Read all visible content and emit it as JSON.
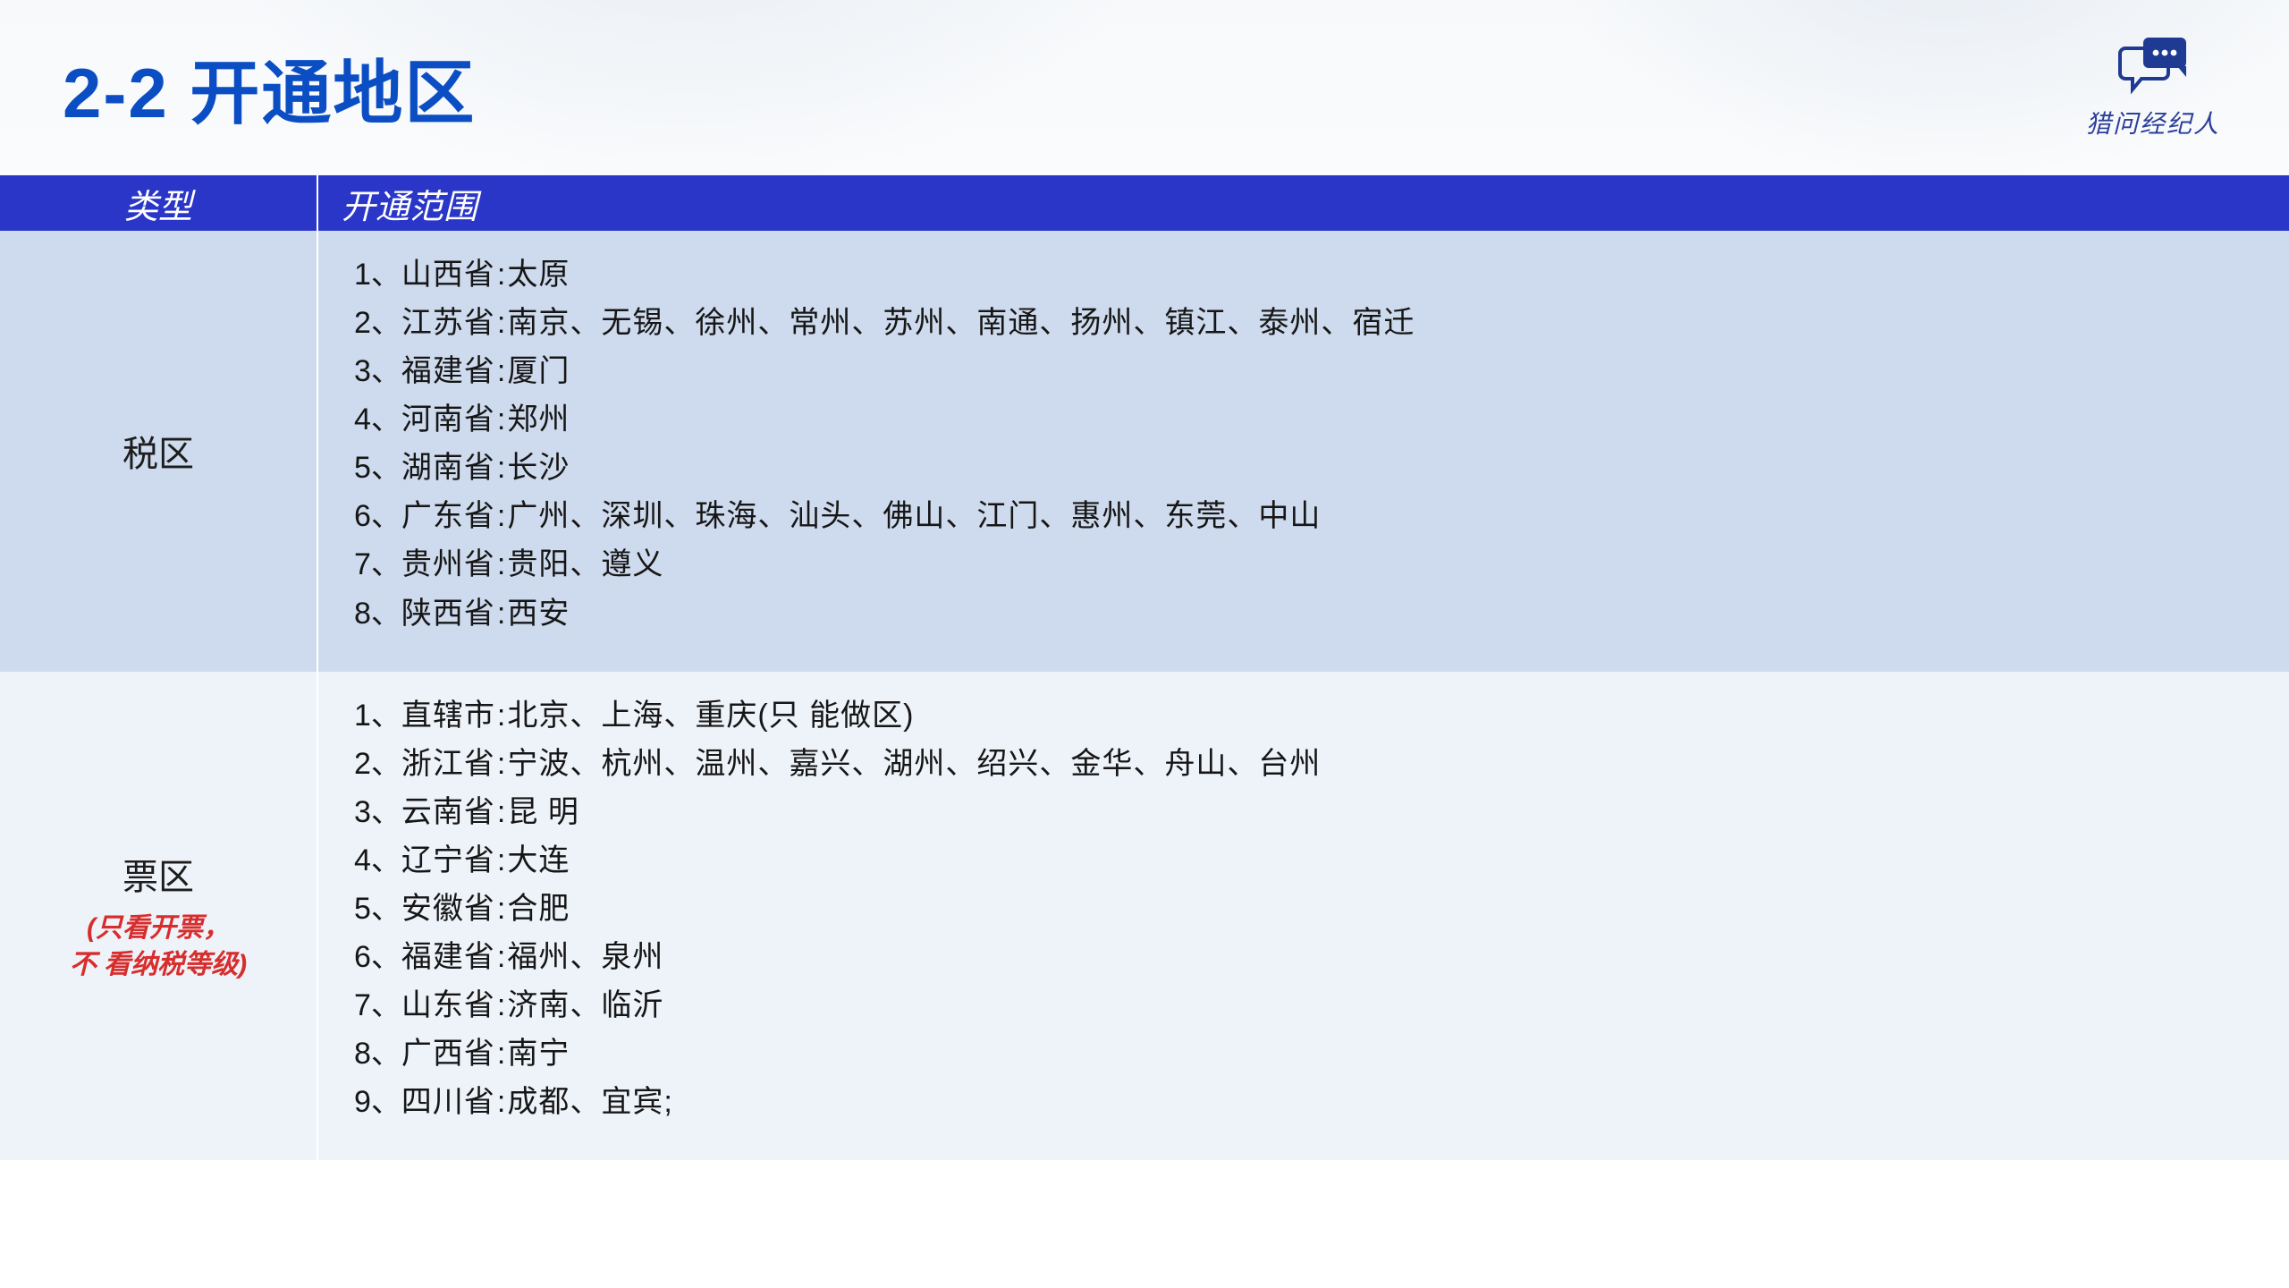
{
  "title": "2-2 开通地区",
  "brand": {
    "label": "猎问经纪人"
  },
  "table": {
    "headers": {
      "type": "类型",
      "scope": "开通范围"
    },
    "rows": [
      {
        "id": "tax",
        "type_label": "税区",
        "type_sub": [],
        "items": [
          {
            "prov": "山西省",
            "cities": "太原"
          },
          {
            "prov": "江苏省",
            "cities": "南京、无锡、徐州、常州、苏州、南通、扬州、镇江、泰州、宿迁"
          },
          {
            "prov": "福建省",
            "cities": "厦门"
          },
          {
            "prov": "河南省",
            "cities": "郑州"
          },
          {
            "prov": "湖南省",
            "cities": "长沙"
          },
          {
            "prov": "广东省",
            "cities": "广州、深圳、珠海、汕头、佛山、江门、惠州、东莞、中山"
          },
          {
            "prov": "贵州省",
            "cities": "贵阳、遵义"
          },
          {
            "prov": "陕西省",
            "cities": "西安"
          }
        ]
      },
      {
        "id": "bill",
        "type_label": "票区",
        "type_sub": [
          "(只看开票，",
          "不 看纳税等级)"
        ],
        "items": [
          {
            "prov": "直辖市",
            "cities": "北京、上海、重庆(只 能做区)"
          },
          {
            "prov": "浙江省",
            "cities": "宁波、杭州、温州、嘉兴、湖州、绍兴、金华、舟山、台州"
          },
          {
            "prov": "云南省",
            "cities": "昆 明"
          },
          {
            "prov": "辽宁省",
            "cities": "大连"
          },
          {
            "prov": "安徽省",
            "cities": "合肥"
          },
          {
            "prov": "福建省",
            "cities": "福州、泉州"
          },
          {
            "prov": "山东省",
            "cities": "济南、临沂"
          },
          {
            "prov": "广西省",
            "cities": "南宁"
          },
          {
            "prov": "四川省",
            "cities": "成都、宜宾;"
          }
        ]
      }
    ]
  }
}
